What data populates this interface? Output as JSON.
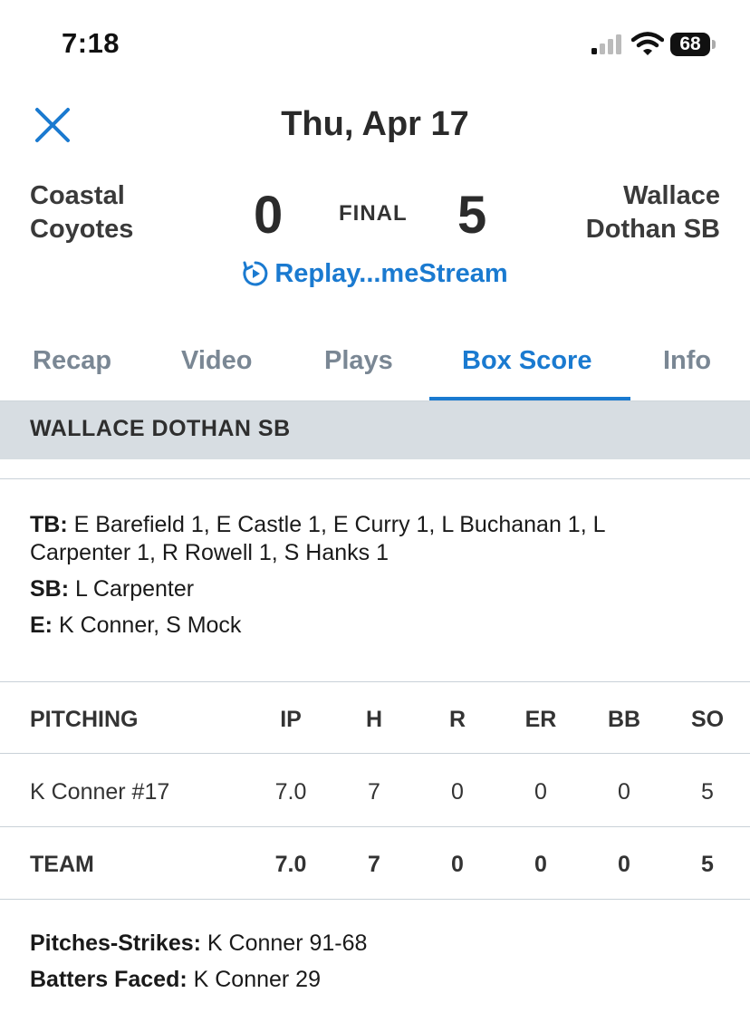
{
  "status": {
    "time": "7:18",
    "battery": "68"
  },
  "header": {
    "date": "Thu, Apr 17",
    "away_team": [
      "Coastal",
      "Coyotes"
    ],
    "home_team": [
      "Wallace",
      "Dothan SB"
    ],
    "away_score": "0",
    "home_score": "5",
    "status": "FINAL",
    "replay_label": "Replay...meStream"
  },
  "tabs": [
    "Recap",
    "Video",
    "Plays",
    "Box Score",
    "Info"
  ],
  "active_tab": "Box Score",
  "section": {
    "title": "WALLACE DOTHAN SB"
  },
  "notes": {
    "tb_label": "TB:",
    "tb_line1": " E Barefield 1, E Castle 1, E Curry 1, L Buchanan 1, L",
    "tb_line2": "Carpenter 1, R Rowell 1, S Hanks 1",
    "sb_label": "SB:",
    "sb_value": " L Carpenter",
    "e_label": "E:",
    "e_value": " K Conner, S Mock"
  },
  "pitching": {
    "headers": [
      "PITCHING",
      "IP",
      "H",
      "R",
      "ER",
      "BB",
      "SO"
    ],
    "rows": [
      [
        "K Conner #17",
        "7.0",
        "7",
        "0",
        "0",
        "0",
        "5"
      ]
    ],
    "team": [
      "TEAM",
      "7.0",
      "7",
      "0",
      "0",
      "0",
      "5"
    ]
  },
  "footer": {
    "ps_label": "Pitches-Strikes:",
    "ps_value": " K Conner 91-68",
    "bf_label": "Batters Faced:",
    "bf_value": " K Conner 29"
  },
  "colors": {
    "accent": "#1a7ad0",
    "section_bg": "#d7dde2",
    "tab_inactive": "#7a8794"
  }
}
